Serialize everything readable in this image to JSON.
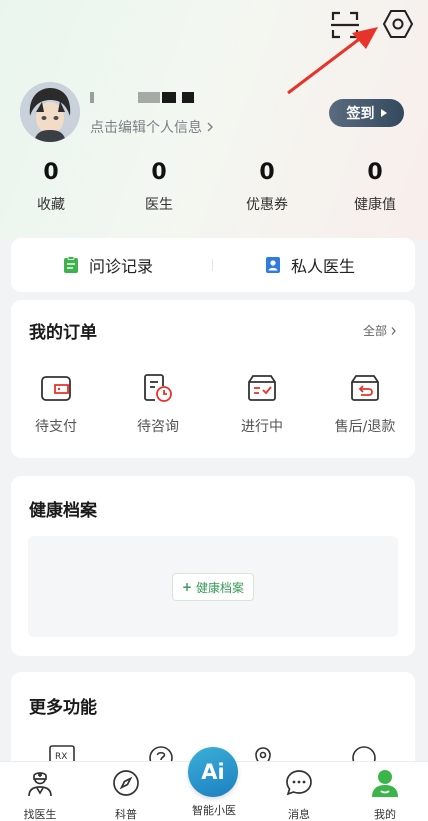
{
  "header": {
    "scan_icon": "scan-icon",
    "settings_icon": "hexagon-gear-icon",
    "annotation": "red-arrow-pointing-to-settings",
    "colors": {
      "arrow": "#e8332a"
    }
  },
  "profile": {
    "edit_link": "点击编辑个人信息",
    "signin_label": "签到"
  },
  "stats": [
    {
      "value": "0",
      "label": "收藏"
    },
    {
      "value": "0",
      "label": "医生"
    },
    {
      "value": "0",
      "label": "优惠券"
    },
    {
      "value": "0",
      "label": "健康值"
    }
  ],
  "quick_links": [
    {
      "label": "问诊记录",
      "icon": "clipboard-icon",
      "color": "#3fb24f"
    },
    {
      "label": "私人医生",
      "icon": "doctor-badge-icon",
      "color": "#2f7be0"
    }
  ],
  "orders": {
    "title": "我的订单",
    "all_label": "全部",
    "items": [
      {
        "label": "待支付",
        "icon": "wallet-icon"
      },
      {
        "label": "待咨询",
        "icon": "consult-clock-icon"
      },
      {
        "label": "进行中",
        "icon": "in-progress-box-icon"
      },
      {
        "label": "售后/退款",
        "icon": "refund-icon"
      }
    ],
    "colors": {
      "accent": "#e8332a",
      "stroke": "#333333"
    }
  },
  "health": {
    "title": "健康档案",
    "add_label": "健康档案"
  },
  "more": {
    "title": "更多功能"
  },
  "tabbar": {
    "items": [
      {
        "label": "找医生",
        "icon": "doctor-icon"
      },
      {
        "label": "科普",
        "icon": "compass-icon"
      },
      {
        "label": "智能小医",
        "icon": "ai-icon"
      },
      {
        "label": "消息",
        "icon": "chat-bubble-icon"
      },
      {
        "label": "我的",
        "icon": "person-icon",
        "active": true
      }
    ],
    "ai_text": "Ai",
    "colors": {
      "active": "#3bb54a",
      "ai_bg": "#2a95cc"
    }
  }
}
